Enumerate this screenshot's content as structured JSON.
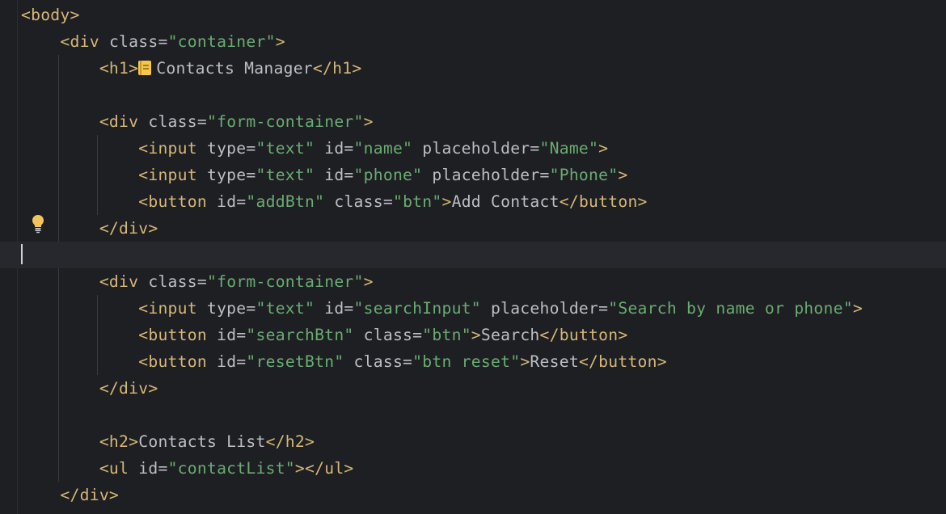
{
  "editor": {
    "language": "html",
    "lines": [
      {
        "id": "body_open",
        "tokens": [
          {
            "t": "tg",
            "v": "<body>"
          }
        ]
      },
      {
        "id": "container_open",
        "tokens": [
          {
            "t": "tg",
            "v": "<div"
          },
          {
            "t": "at",
            "v": " class="
          },
          {
            "t": "st",
            "v": "\"container\""
          },
          {
            "t": "tg",
            "v": ">"
          }
        ]
      },
      {
        "id": "h1",
        "tokens": [
          {
            "t": "tg",
            "v": "<h1>"
          },
          {
            "t": "emoji",
            "v": "notebook-emoji"
          },
          {
            "t": "tx",
            "v": "Contacts Manager"
          },
          {
            "t": "tg",
            "v": "</h1>"
          }
        ]
      },
      {
        "id": "blank1",
        "tokens": []
      },
      {
        "id": "form1_open",
        "tokens": [
          {
            "t": "tg",
            "v": "<div"
          },
          {
            "t": "at",
            "v": " class="
          },
          {
            "t": "st",
            "v": "\"form-container\""
          },
          {
            "t": "tg",
            "v": ">"
          }
        ]
      },
      {
        "id": "input_name",
        "tokens": [
          {
            "t": "tg",
            "v": "<input"
          },
          {
            "t": "at",
            "v": " type="
          },
          {
            "t": "st",
            "v": "\"text\""
          },
          {
            "t": "at",
            "v": " id="
          },
          {
            "t": "st",
            "v": "\"name\""
          },
          {
            "t": "at",
            "v": " placeholder="
          },
          {
            "t": "st",
            "v": "\"Name\""
          },
          {
            "t": "tg",
            "v": ">"
          }
        ]
      },
      {
        "id": "input_phone",
        "tokens": [
          {
            "t": "tg",
            "v": "<input"
          },
          {
            "t": "at",
            "v": " type="
          },
          {
            "t": "st",
            "v": "\"text\""
          },
          {
            "t": "at",
            "v": " id="
          },
          {
            "t": "st",
            "v": "\"phone\""
          },
          {
            "t": "at",
            "v": " placeholder="
          },
          {
            "t": "st",
            "v": "\"Phone\""
          },
          {
            "t": "tg",
            "v": ">"
          }
        ]
      },
      {
        "id": "add_btn",
        "tokens": [
          {
            "t": "tg",
            "v": "<button"
          },
          {
            "t": "at",
            "v": " id="
          },
          {
            "t": "st",
            "v": "\"addBtn\""
          },
          {
            "t": "at",
            "v": " class="
          },
          {
            "t": "st",
            "v": "\"btn\""
          },
          {
            "t": "tg",
            "v": ">"
          },
          {
            "t": "tx",
            "v": "Add Contact"
          },
          {
            "t": "tg",
            "v": "</button>"
          }
        ]
      },
      {
        "id": "form1_close",
        "tokens": [
          {
            "t": "tg",
            "v": "</div>"
          }
        ]
      },
      {
        "id": "blank2",
        "tokens": []
      },
      {
        "id": "form2_open",
        "tokens": [
          {
            "t": "tg",
            "v": "<div"
          },
          {
            "t": "at",
            "v": " class="
          },
          {
            "t": "st",
            "v": "\"form-container\""
          },
          {
            "t": "tg",
            "v": ">"
          }
        ]
      },
      {
        "id": "search_input",
        "tokens": [
          {
            "t": "tg",
            "v": "<input"
          },
          {
            "t": "at",
            "v": " type="
          },
          {
            "t": "st",
            "v": "\"text\""
          },
          {
            "t": "at",
            "v": " id="
          },
          {
            "t": "st",
            "v": "\"searchInput\""
          },
          {
            "t": "at",
            "v": " placeholder="
          },
          {
            "t": "st",
            "v": "\"Search by name or phone\""
          },
          {
            "t": "tg",
            "v": ">"
          }
        ]
      },
      {
        "id": "search_btn",
        "tokens": [
          {
            "t": "tg",
            "v": "<button"
          },
          {
            "t": "at",
            "v": " id="
          },
          {
            "t": "st",
            "v": "\"searchBtn\""
          },
          {
            "t": "at",
            "v": " class="
          },
          {
            "t": "st",
            "v": "\"btn\""
          },
          {
            "t": "tg",
            "v": ">"
          },
          {
            "t": "tx",
            "v": "Search"
          },
          {
            "t": "tg",
            "v": "</button>"
          }
        ]
      },
      {
        "id": "reset_btn",
        "tokens": [
          {
            "t": "tg",
            "v": "<button"
          },
          {
            "t": "at",
            "v": " id="
          },
          {
            "t": "st",
            "v": "\"resetBtn\""
          },
          {
            "t": "at",
            "v": " class="
          },
          {
            "t": "st",
            "v": "\"btn reset\""
          },
          {
            "t": "tg",
            "v": ">"
          },
          {
            "t": "tx",
            "v": "Reset"
          },
          {
            "t": "tg",
            "v": "</button>"
          }
        ]
      },
      {
        "id": "form2_close",
        "tokens": [
          {
            "t": "tg",
            "v": "</div>"
          }
        ]
      },
      {
        "id": "blank3",
        "tokens": []
      },
      {
        "id": "h2",
        "tokens": [
          {
            "t": "tg",
            "v": "<h2>"
          },
          {
            "t": "tx",
            "v": "Contacts List"
          },
          {
            "t": "tg",
            "v": "</h2>"
          }
        ]
      },
      {
        "id": "ul",
        "tokens": [
          {
            "t": "tg",
            "v": "<ul"
          },
          {
            "t": "at",
            "v": " id="
          },
          {
            "t": "st",
            "v": "\"contactList\""
          },
          {
            "t": "tg",
            "v": "></ul>"
          }
        ]
      },
      {
        "id": "container_close",
        "tokens": [
          {
            "t": "tg",
            "v": "</div>"
          }
        ]
      }
    ]
  },
  "icons": {
    "lightbulb": "intention-bulb-icon",
    "emoji": "notebook-emoji"
  },
  "colors": {
    "background": "#1e1f22",
    "current_line": "#26282e",
    "tag": "#d5b778",
    "attribute": "#bcbec4",
    "string": "#6aab73",
    "text": "#bcbec4",
    "bulb": "#f2c55c"
  }
}
